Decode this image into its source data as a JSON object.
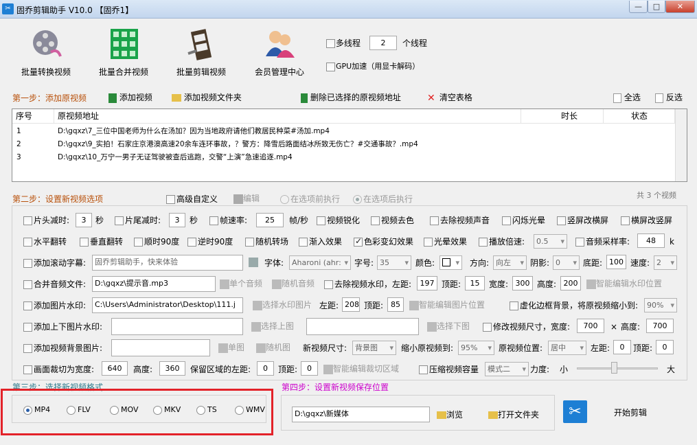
{
  "window": {
    "title": "固乔剪辑助手 V10.0 【固乔1】"
  },
  "toolbar": {
    "batch_convert": "批量转换视频",
    "batch_merge": "批量合并视频",
    "batch_edit": "批量剪辑视频",
    "member_center": "会员管理中心",
    "multithread": "多线程",
    "thread_count": "2",
    "thread_unit": "个线程",
    "gpu": "GPU加速（用显卡解码）"
  },
  "step1": {
    "header": "第一步：添加原视频",
    "add_video": "添加视频",
    "add_folder": "添加视频文件夹",
    "delete_selected": "删除已选择的原视频地址",
    "clear_table": "清空表格",
    "select_all": "全选",
    "invert": "反选"
  },
  "table": {
    "columns": [
      "序号",
      "原视频地址",
      "时长",
      "状态"
    ],
    "rows": [
      {
        "no": "1",
        "path": "D:\\gqxz\\7_三位中国老师为什么在汤加？因为当地政府请他们教居民种菜#汤加.mp4"
      },
      {
        "no": "2",
        "path": "D:\\gqxz\\9_实拍！石家庄京港澳高速20余车连环事故，？警方：降雪后路面结冰所致无伤亡？#交通事故？.mp4"
      },
      {
        "no": "3",
        "path": "D:\\gqxz\\10_万宁一男子无证驾驶被查后逃跑，交警“上演”急速追逐.mp4"
      }
    ]
  },
  "step2": {
    "header": "第二步：设置新视频选项",
    "advanced": "高级自定义",
    "edit": "编辑",
    "before": "在选项前执行",
    "after": "在选项后执行",
    "count": "共 3 个视频",
    "r1": {
      "head_cut": "片头减时:",
      "head_val": "3",
      "sec": "秒",
      "tail_cut": "片尾减时:",
      "tail_val": "3",
      "sec2": "秒",
      "fps": "帧速率:",
      "fps_val": "25",
      "fps_unit": "帧/秒",
      "sharpen": "视频锐化",
      "decolor": "视频去色",
      "mute": "去除视频声音",
      "flash": "闪烁光晕",
      "v2h": "竖屏改横屏",
      "h2v": "横屏改竖屏"
    },
    "r2": {
      "hflip": "水平翻转",
      "vflip": "垂直翻转",
      "cw90": "顺时90度",
      "ccw90": "逆时90度",
      "transition": "随机转场",
      "fadein": "渐入效果",
      "colorfx": "色彩变幻效果",
      "halo": "光晕效果",
      "speed": "播放倍速:",
      "speed_val": "0.5",
      "samplerate": "音频采样率:",
      "samplerate_val": "48",
      "k": "k"
    },
    "r3": {
      "scroll": "添加滚动字幕:",
      "scroll_text": "固乔剪辑助手，快来体验",
      "font": "字体:",
      "font_val": "Aharoni (ahr:",
      "size": "字号:",
      "size_val": "35",
      "color": "颜色:",
      "dir": "方向:",
      "dir_val": "向左",
      "shadow": "阴影:",
      "shadow_val": "0",
      "bottom": "底距:",
      "bottom_val": "100",
      "spd": "速度:",
      "spd_val": "2"
    },
    "r4": {
      "merge_audio": "合并音频文件:",
      "audio_path": "D:\\gqxz\\提示音.mp3",
      "single_audio": "单个音频",
      "random_audio": "随机音频",
      "rm_wm": "去除视频水印，左距:",
      "left_val": "197",
      "top": "顶距:",
      "top_val": "15",
      "width": "宽度:",
      "width_val": "300",
      "height": "高度:",
      "height_val": "200",
      "smart_wm": "智能编辑水印位置"
    },
    "r5": {
      "img_wm": "添加图片水印:",
      "img_path": "C:\\Users\\Administrator\\Desktop\\111.j",
      "choose_img": "选择水印图片",
      "left": "左距:",
      "left_val": "208",
      "top": "顶距:",
      "top_val": "85",
      "smart_img": "智能编辑图片位置",
      "blur": "虚化边框背景，将原视频缩小到:",
      "blur_val": "90%"
    },
    "r6": {
      "updown": "添加上下图片水印:",
      "choose_up": "选择上图",
      "choose_down": "选择下图",
      "resize": "修改视频尺寸，宽度:",
      "w_val": "700",
      "x": "×",
      "h": "高度:",
      "h_val": "700"
    },
    "r7": {
      "bgimg": "添加视频背景图片:",
      "single": "单图",
      "random": "随机图",
      "new_size": "新视频尺寸:",
      "new_size_val": "背景图",
      "shrink": "缩小原视频到:",
      "shrink_val": "95%",
      "pos": "原视频位置:",
      "pos_val": "居中",
      "left": "左距:",
      "left_val": "0",
      "top": "顶距:",
      "top_val": "0"
    },
    "r8": {
      "crop": "画面裁切为宽度:",
      "crop_w": "640",
      "h": "高度:",
      "crop_h": "360",
      "keep_left": "保留区域的左距:",
      "keep_left_val": "0",
      "top": "顶距:",
      "top_val": "0",
      "smart_crop": "智能编辑裁切区域",
      "compress": "压缩视频容量",
      "mode_val": "模式二",
      "force": "力度:",
      "small": "小",
      "big": "大"
    }
  },
  "step3": {
    "header": "第三步：选择新视频格式",
    "formats": [
      "MP4",
      "FLV",
      "MOV",
      "MKV",
      "TS",
      "WMV"
    ]
  },
  "step4": {
    "header": "第四步：设置新视频保存位置",
    "path": "D:\\gqxz\\新媒体",
    "browse": "浏览",
    "open_folder": "打开文件夹",
    "start": "开始剪辑"
  },
  "colors": {
    "highlight_border": "#e32229",
    "header": "#b8500a",
    "step4": "#cc00cc"
  }
}
